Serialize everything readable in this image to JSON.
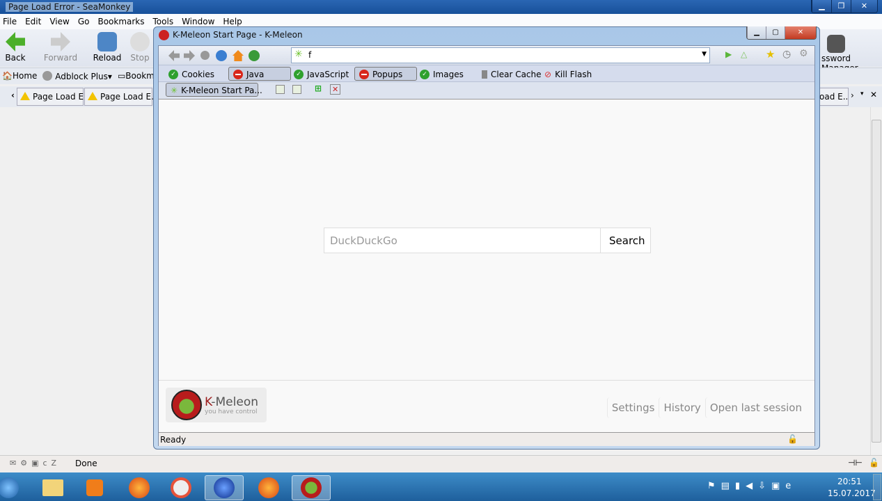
{
  "seamonkey": {
    "title": "Page Load Error - SeaMonkey",
    "menu": [
      "File",
      "Edit",
      "View",
      "Go",
      "Bookmarks",
      "Tools",
      "Window",
      "Help"
    ],
    "toolbar": {
      "back": "Back",
      "forward": "Forward",
      "reload": "Reload",
      "stop": "Stop",
      "password_manager": "ssword Manager"
    },
    "bookmarks": [
      "Home",
      "Adblock Plus",
      "Bookma"
    ],
    "tabs": [
      "Page Load E...",
      "Page Load E...",
      "oad E..."
    ],
    "status": "Done"
  },
  "kmeleon": {
    "title": "K-Meleon Start Page - K-Meleon",
    "url": "f",
    "toggles": [
      {
        "label": "Cookies",
        "state": "on"
      },
      {
        "label": "Java",
        "state": "off"
      },
      {
        "label": "JavaScript",
        "state": "on"
      },
      {
        "label": "Popups",
        "state": "off"
      },
      {
        "label": "Images",
        "state": "on"
      },
      {
        "label": "Clear Cache",
        "state": "action"
      },
      {
        "label": "Kill Flash",
        "state": "action"
      }
    ],
    "tab": "K-Meleon Start Pa...",
    "search": {
      "placeholder": "DuckDuckGo",
      "button": "Search"
    },
    "logo": {
      "name": "K-Meleon",
      "tagline": "you have control"
    },
    "footer_links": [
      "Settings",
      "History",
      "Open last session"
    ],
    "status": "Ready"
  },
  "taskbar": {
    "time": "20:51",
    "date": "15.07.2017"
  }
}
